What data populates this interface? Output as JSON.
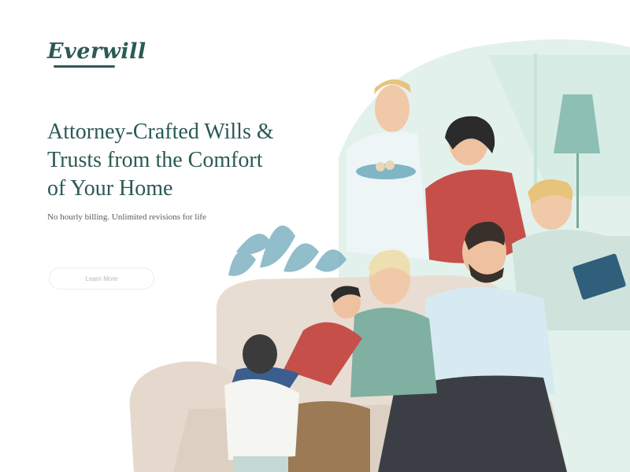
{
  "brand": {
    "logo_text": "Everwill"
  },
  "hero": {
    "headline_line1": "Attorney-Crafted Wills &",
    "headline_line2": "Trusts from the Comfort",
    "headline_line3": "of Your Home",
    "subheadline": "No hourly billing. Unlimited revisions for life",
    "cta_label": "Learn More"
  },
  "colors": {
    "brand": "#2c5a55",
    "mint": "#e3f1ec",
    "sofa": "#e8ddd2",
    "red": "#c65049",
    "blue_shirt": "#d8eaf1"
  },
  "illustration": {
    "subject": "family-on-sofa-illustration"
  }
}
